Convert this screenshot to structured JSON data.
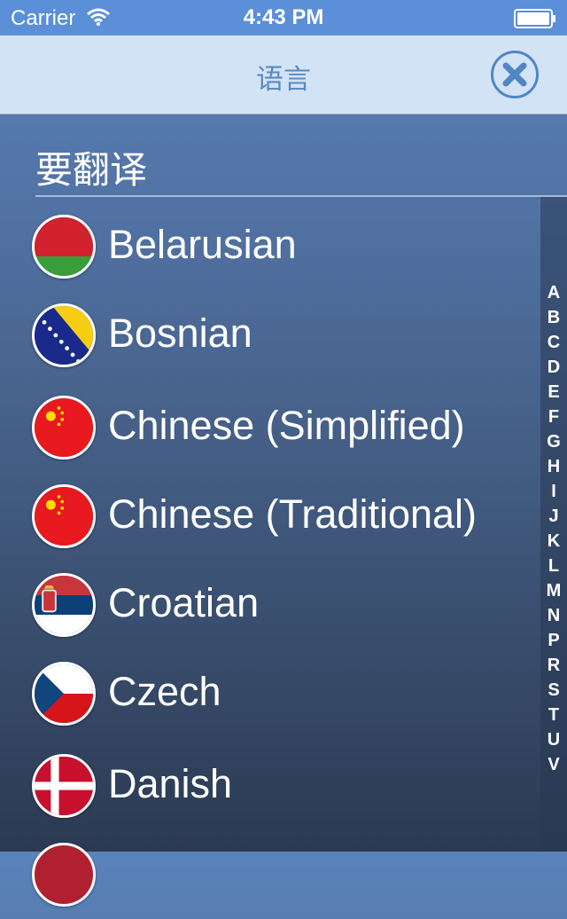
{
  "status_bar": {
    "carrier": "Carrier",
    "time": "4:43 PM"
  },
  "nav": {
    "title": "语言",
    "close_icon": "close-icon"
  },
  "section": {
    "title": "要翻译"
  },
  "languages": [
    {
      "label": "Belarusian",
      "flag": "belarus"
    },
    {
      "label": "Bosnian",
      "flag": "bosnia"
    },
    {
      "label": "Chinese (Simplified)",
      "flag": "china"
    },
    {
      "label": "Chinese (Traditional)",
      "flag": "china"
    },
    {
      "label": "Croatian",
      "flag": "serbia-style"
    },
    {
      "label": "Czech",
      "flag": "czech"
    },
    {
      "label": "Danish",
      "flag": "denmark"
    }
  ],
  "index_letters": [
    "A",
    "B",
    "C",
    "D",
    "E",
    "F",
    "G",
    "H",
    "I",
    "J",
    "K",
    "L",
    "M",
    "N",
    "P",
    "R",
    "S",
    "T",
    "U",
    "V"
  ],
  "colors": {
    "status_bar": "#5b8fd7",
    "nav_bar": "#d3e3f6",
    "accent": "#4f86c6"
  }
}
